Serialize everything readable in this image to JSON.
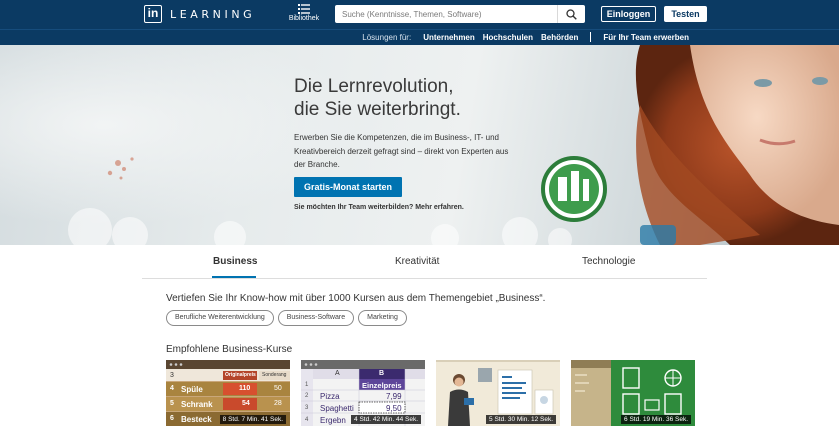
{
  "header": {
    "brand": "LEARNING",
    "brand_mark": "in",
    "library_label": "Bibliothek",
    "search_placeholder": "Suche (Kenntnisse, Themen, Software)",
    "login_label": "Einloggen",
    "try_label": "Testen"
  },
  "subnav": {
    "lead": "Lösungen für:",
    "items": [
      "Unternehmen",
      "Hochschulen",
      "Behörden"
    ],
    "team": "Für Ihr Team erwerben"
  },
  "hero": {
    "title_line1": "Die Lernrevolution,",
    "title_line2": "die Sie weiterbringt.",
    "text": "Erwerben Sie die Kompetenzen, die im Business-, IT- und Kreativbereich derzeit gefragt sind – direkt von Experten aus der Branche.",
    "cta_label": "Gratis-Monat starten",
    "team_link": "Sie möchten Ihr Team weiterbilden? Mehr erfahren."
  },
  "tabs": [
    {
      "label": "Business",
      "active": true
    },
    {
      "label": "Kreativität",
      "active": false
    },
    {
      "label": "Technologie",
      "active": false
    }
  ],
  "business": {
    "intro": "Vertiefen Sie Ihr Know-how mit über 1000 Kursen aus dem Themengebiet „Business“.",
    "chips": [
      "Berufliche Weiterentwicklung",
      "Business-Software",
      "Marketing"
    ],
    "featured_title": "Empfohlene Business-Kurse"
  },
  "courses": [
    {
      "duration": "8 Std. 7 Min. 41 Sek.",
      "sheet": {
        "headers": [
          "Originalpreis",
          "Sonderang"
        ],
        "rows": [
          {
            "num": "3",
            "name": "",
            "v1": "",
            "v2": ""
          },
          {
            "num": "4",
            "name": "Spüle",
            "v1": "110",
            "v2": "50"
          },
          {
            "num": "5",
            "name": "Schrank",
            "v1": "54",
            "v2": "28"
          },
          {
            "num": "6",
            "name": "Besteck",
            "v1": "",
            "v2": ""
          }
        ]
      }
    },
    {
      "duration": "4 Std. 42 Min. 44 Sek.",
      "sheet": {
        "col_a": "A",
        "col_b": "B",
        "header_b": "Einzelpreis",
        "rows": [
          {
            "num": "1",
            "a": "",
            "b": ""
          },
          {
            "num": "2",
            "a": "Pizza",
            "b": "7,99"
          },
          {
            "num": "3",
            "a": "Spaghetti",
            "b": "9,50"
          },
          {
            "num": "4",
            "a": "Ergebn",
            "b": ""
          }
        ]
      }
    },
    {
      "duration": "5 Std. 30 Min. 12 Sek."
    },
    {
      "duration": "6 Std. 19 Min. 36 Sek."
    }
  ],
  "colors": {
    "navy": "#0b3a63",
    "accent": "#0073b1"
  }
}
